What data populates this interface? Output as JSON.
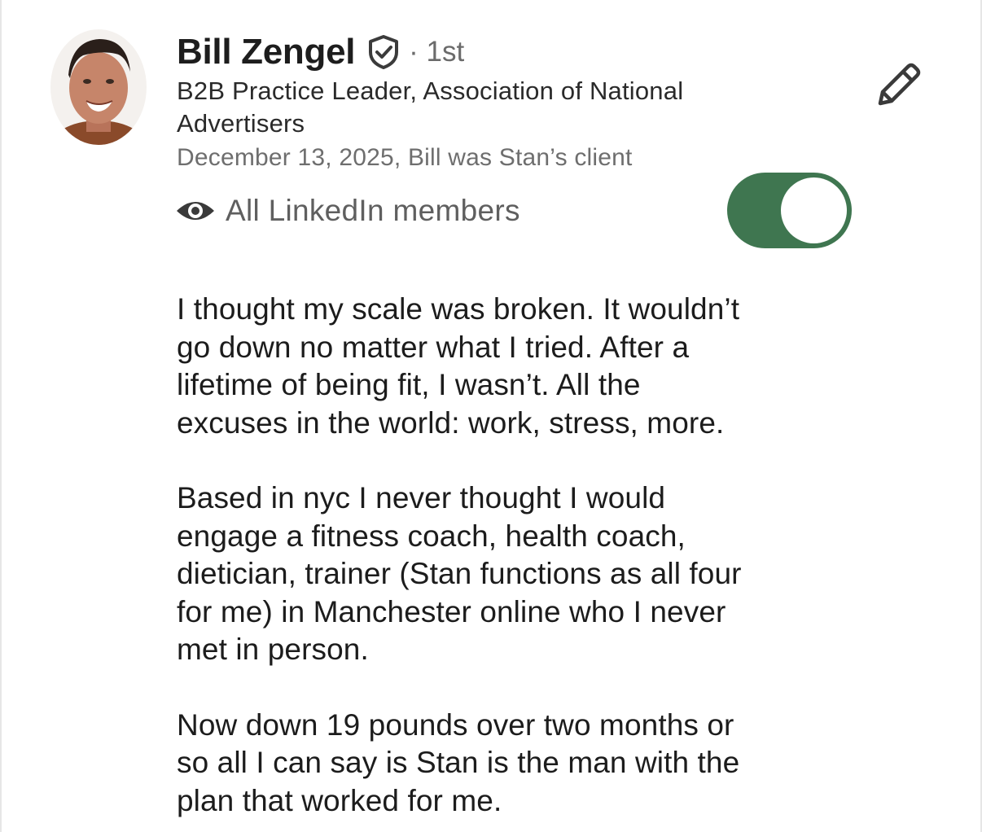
{
  "recommender": {
    "name": "Bill Zengel",
    "verified_icon": "verified-shield-icon",
    "degree": "· 1st",
    "headline_line1": "B2B Practice Leader, Association of National",
    "headline_line2": "Advertisers",
    "meta": "December 13, 2025, Bill was Stan’s client"
  },
  "actions": {
    "edit_icon": "pencil-icon"
  },
  "visibility": {
    "icon": "eye-icon",
    "label": "All LinkedIn members",
    "toggle_on": true,
    "toggle_color": "#3f7650"
  },
  "recommendation": {
    "paragraph1": "I thought my scale was broken.  It wouldn’t\ngo down no matter what I tried. After a\nlifetime of being fit, I wasn’t. All the\nexcuses in the world: work, stress, more.",
    "paragraph2": "Based in nyc I never thought I would\nengage a fitness coach, health coach,\ndietician, trainer (Stan functions as all four\nfor me) in Manchester online who I never\nmet in person.",
    "paragraph3": "Now down 19 pounds over two months or\nso all I can say is Stan is the man with the\nplan that worked for me."
  }
}
